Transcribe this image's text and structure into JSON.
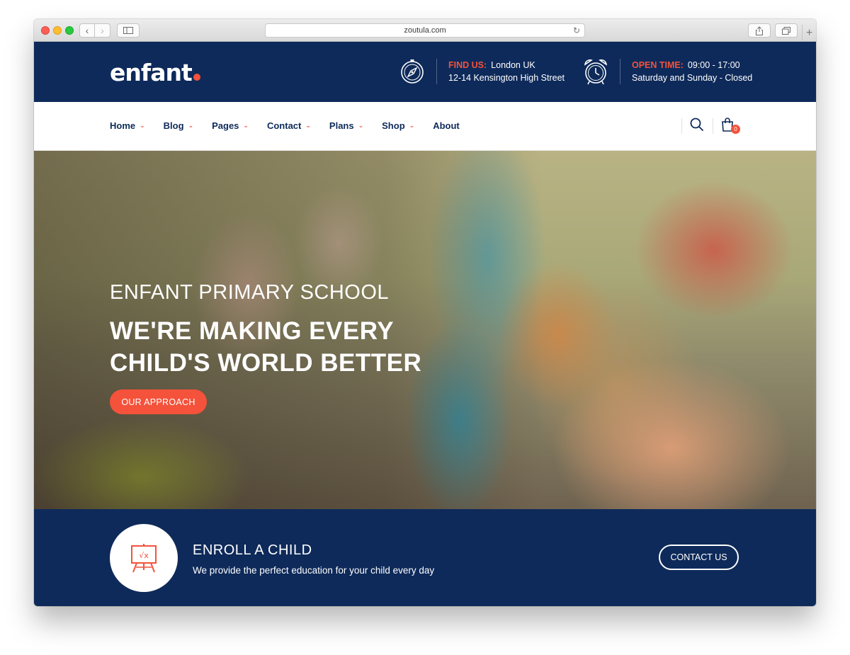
{
  "browser": {
    "url": "zoutula.com"
  },
  "site": {
    "logo": "enfant"
  },
  "topbar": {
    "find_us": {
      "key": "FIND US:",
      "line1": "London UK",
      "line2": "12-14 Kensington High Street"
    },
    "open_time": {
      "key": "OPEN TIME:",
      "line1": "09:00 - 17:00",
      "line2": "Saturday and Sunday - Closed"
    }
  },
  "nav": {
    "items": [
      {
        "label": "Home",
        "has_dropdown": true
      },
      {
        "label": "Blog",
        "has_dropdown": true
      },
      {
        "label": "Pages",
        "has_dropdown": true
      },
      {
        "label": "Contact",
        "has_dropdown": true
      },
      {
        "label": "Plans",
        "has_dropdown": true
      },
      {
        "label": "Shop",
        "has_dropdown": true
      },
      {
        "label": "About",
        "has_dropdown": false
      }
    ],
    "cart_count": "0"
  },
  "hero": {
    "subtitle": "ENFANT PRIMARY SCHOOL",
    "title_line1": "WE'RE MAKING EVERY",
    "title_line2": "CHILD'S WORLD BETTER",
    "cta": "OUR APPROACH"
  },
  "enroll": {
    "title": "ENROLL A CHILD",
    "description": "We provide the perfect education for your child every day",
    "cta": "CONTACT US",
    "icon": "chalkboard-icon"
  },
  "colors": {
    "navy": "#0e2a5a",
    "accent": "#f4523b"
  }
}
